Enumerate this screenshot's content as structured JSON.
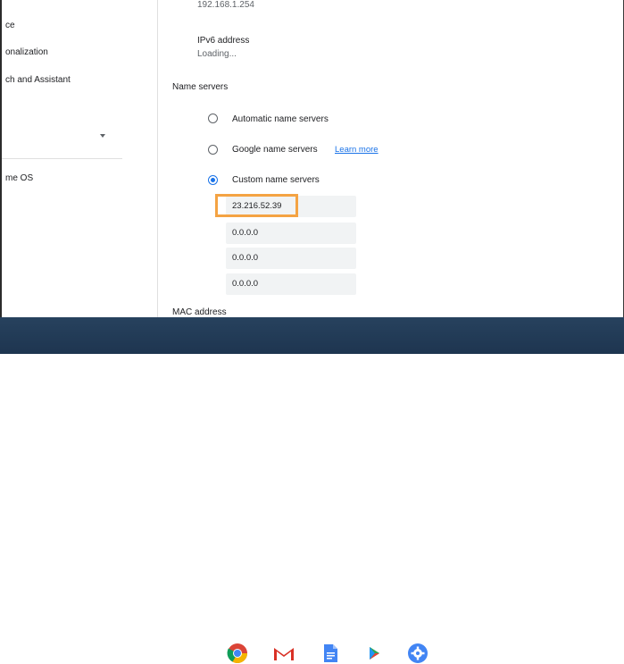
{
  "sidebar": {
    "items": [
      {
        "label": "ce"
      },
      {
        "label": "onalization"
      },
      {
        "label": "ch and Assistant"
      },
      {
        "label": "me OS"
      }
    ]
  },
  "network": {
    "gateway_value": "192.168.1.254",
    "ipv6_label": "IPv6 address",
    "ipv6_value": "Loading...",
    "name_servers_label": "Name servers",
    "options": [
      {
        "label": "Automatic name servers",
        "checked": false
      },
      {
        "label": "Google name servers",
        "checked": false,
        "link": "Learn more"
      },
      {
        "label": "Custom name servers",
        "checked": true
      }
    ],
    "custom_servers": [
      "23.216.52.39",
      "0.0.0.0",
      "0.0.0.0",
      "0.0.0.0"
    ],
    "mac_label": "MAC address"
  },
  "shelf": {
    "apps": [
      "chrome-icon",
      "gmail-icon",
      "docs-icon",
      "play-store-icon",
      "settings-icon"
    ]
  },
  "colors": {
    "accent": "#1a73e8",
    "highlight": "#f4a343",
    "shelf": "#1e3550"
  }
}
